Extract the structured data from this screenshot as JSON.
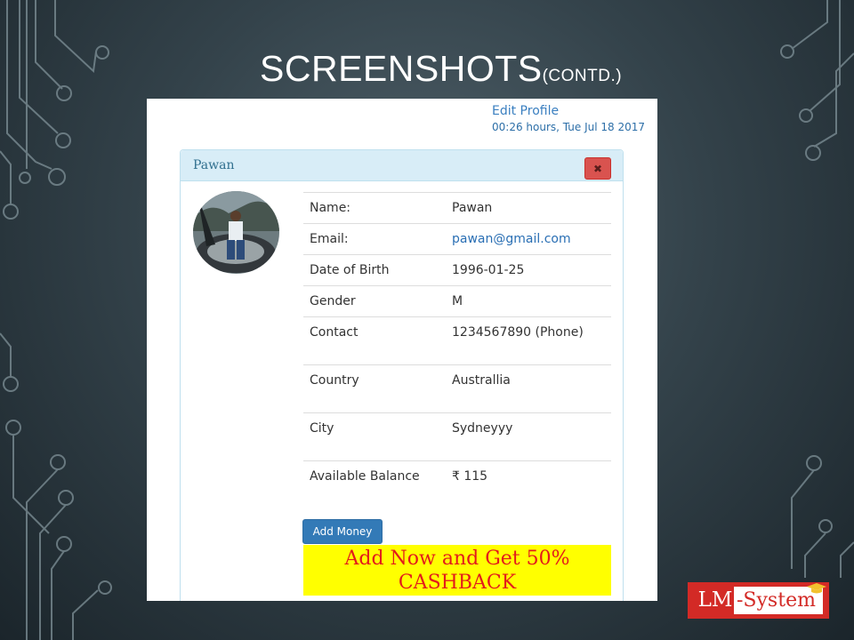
{
  "slide": {
    "title_main": "SCREENSHOTS",
    "title_sub": "(CONTD.)"
  },
  "header": {
    "edit_profile_label": "Edit Profile",
    "timestamp": "00:26 hours, Tue Jul 18 2017"
  },
  "panel": {
    "title": "Pawan",
    "close_icon": "close-icon",
    "close_glyph": "✖"
  },
  "profile": {
    "rows": [
      {
        "label": "Name:",
        "value": "Pawan"
      },
      {
        "label": "Email:",
        "value": "pawan@gmail.com"
      },
      {
        "label": "Date of Birth",
        "value": "1996-01-25"
      },
      {
        "label": "Gender",
        "value": "M"
      },
      {
        "label": "Contact",
        "value": "1234567890 (Phone)"
      },
      {
        "label": "Country",
        "value": "Australlia"
      },
      {
        "label": "City",
        "value": "Sydneyyy"
      },
      {
        "label": "Available Balance",
        "value": "₹ 115"
      }
    ]
  },
  "actions": {
    "add_money_label": "Add Money"
  },
  "promo": {
    "line1": "Add Now and Get 50%",
    "line2": "CASHBACK"
  },
  "logo": {
    "part1": "LM",
    "part2": "-System"
  },
  "colors": {
    "accent": "#337ab7",
    "danger": "#d9534f",
    "panel_heading": "#d8edf7",
    "promo_bg": "#ffff00",
    "promo_text": "#e31b1b",
    "logo_red": "#d32a26"
  }
}
